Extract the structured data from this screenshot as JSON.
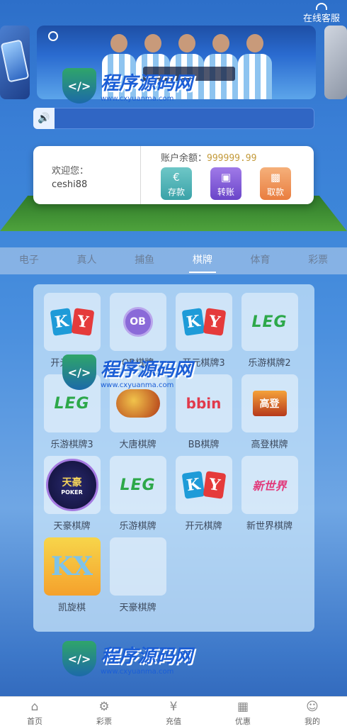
{
  "header": {
    "customer_service": "在线客服",
    "customer_service_icon": "headset-icon"
  },
  "notice": {
    "icon": "speaker-icon",
    "text": ""
  },
  "account": {
    "welcome": "欢迎您：",
    "username": "ceshi88",
    "balance_label": "账户余额：",
    "balance_value": "999999.99",
    "actions": [
      {
        "label": "存款",
        "icon": "euro-icon"
      },
      {
        "label": "转账",
        "icon": "wallet-icon"
      },
      {
        "label": "取款",
        "icon": "withdraw-icon"
      }
    ]
  },
  "tabs": [
    {
      "label": "电子",
      "active": false
    },
    {
      "label": "真人",
      "active": false
    },
    {
      "label": "捕鱼",
      "active": false
    },
    {
      "label": "棋牌",
      "active": true
    },
    {
      "label": "体育",
      "active": false
    },
    {
      "label": "彩票",
      "active": false
    }
  ],
  "games": [
    {
      "label": "开元棋牌2",
      "logo": "KY"
    },
    {
      "label": "OB棋牌",
      "logo": "OB"
    },
    {
      "label": "开元棋牌3",
      "logo": "KY"
    },
    {
      "label": "乐游棋牌2",
      "logo": "LEG"
    },
    {
      "label": "乐游棋牌3",
      "logo": "LEG"
    },
    {
      "label": "大唐棋牌",
      "logo": ""
    },
    {
      "label": "BB棋牌",
      "logo": "bbin"
    },
    {
      "label": "高登棋牌",
      "logo": "高登"
    },
    {
      "label": "天豪棋牌",
      "logo": "天豪",
      "logo_sub": "POKER"
    },
    {
      "label": "乐游棋牌",
      "logo": "LEG"
    },
    {
      "label": "开元棋牌",
      "logo": "KY"
    },
    {
      "label": "新世界棋牌",
      "logo": "新世界"
    },
    {
      "label": "凯旋棋",
      "logo": "KX"
    },
    {
      "label": "天豪棋牌",
      "logo": ""
    }
  ],
  "watermark": {
    "title": "程序源码网",
    "url": "www.cxyuanma.com"
  },
  "bottom_nav": [
    {
      "label": "首页",
      "icon": "home-icon"
    },
    {
      "label": "彩票",
      "icon": "ticket-icon"
    },
    {
      "label": "充值",
      "icon": "yen-icon"
    },
    {
      "label": "优惠",
      "icon": "gift-icon"
    },
    {
      "label": "我的",
      "icon": "user-icon"
    }
  ]
}
